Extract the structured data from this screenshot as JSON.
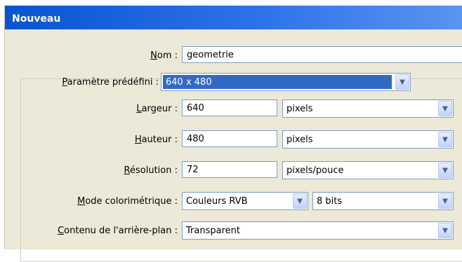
{
  "dialog": {
    "title": "Nouveau"
  },
  "form": {
    "nom": {
      "label_key": "N",
      "label_rest": "om :",
      "value": "geometrie"
    },
    "preset": {
      "label_key": "P",
      "label_rest": "aramètre prédéfini :",
      "value": "640 x 480"
    },
    "largeur": {
      "label_key": "L",
      "label_rest": "argeur :",
      "value": "640",
      "unit": "pixels"
    },
    "hauteur": {
      "label_key": "H",
      "label_rest": "auteur :",
      "value": "480",
      "unit": "pixels"
    },
    "resolution": {
      "label_key": "R",
      "label_rest": "ésolution :",
      "value": "72",
      "unit": "pixels/pouce"
    },
    "mode": {
      "label_key": "M",
      "label_rest": "ode colorimétrique :",
      "value": "Couleurs RVB",
      "bits": "8 bits"
    },
    "contenu": {
      "label_key": "C",
      "label_rest": "ontenu de l'arrière-plan :",
      "value": "Transparent"
    }
  },
  "icons": {
    "dropdown": "chevron-down-icon"
  },
  "colors": {
    "titlebar": "#0a54d0",
    "selection": "#316ac5",
    "dialog_bg": "#ece9d8"
  }
}
